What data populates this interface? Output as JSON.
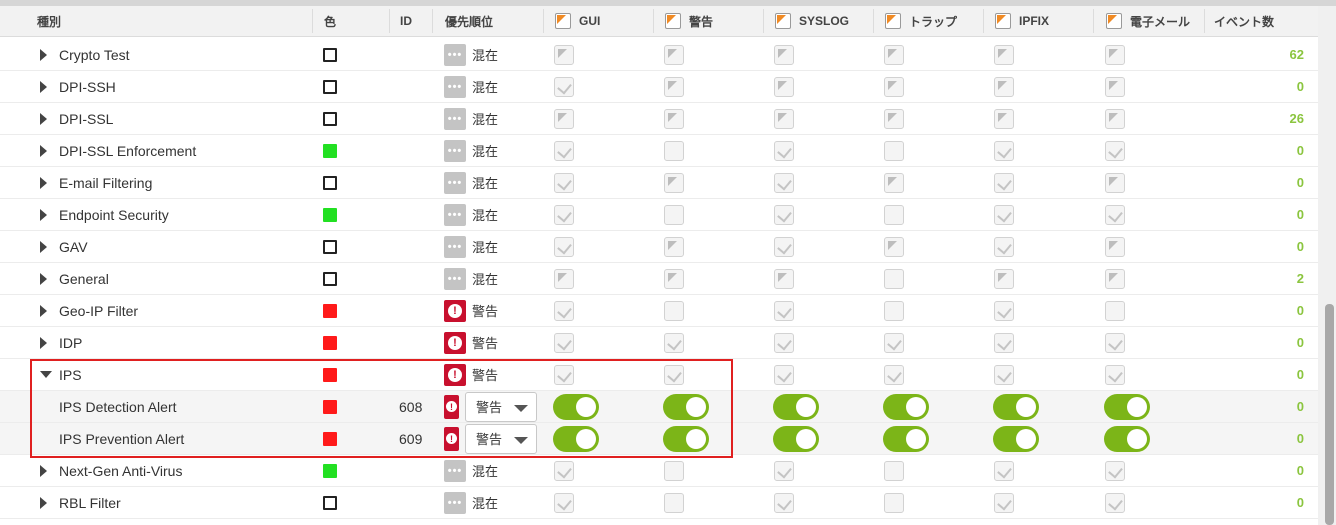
{
  "headers": {
    "type": "種別",
    "color": "色",
    "id": "ID",
    "priority": "優先順位",
    "gui": "GUI",
    "alert": "警告",
    "syslog": "SYSLOG",
    "trap": "トラップ",
    "ipfix": "IPFIX",
    "email": "電子メール",
    "events": "イベント数"
  },
  "rows": [
    {
      "name": "Crypto Test",
      "color": "#ffffff",
      "id": "",
      "priority": "混在",
      "count": "62",
      "expanded": false,
      "checks": [
        "flag",
        "flag",
        "flag",
        "flag",
        "flag",
        "flag"
      ]
    },
    {
      "name": "DPI-SSH",
      "color": "#ffffff",
      "id": "",
      "priority": "混在",
      "count": "0",
      "expanded": false,
      "checks": [
        "tick",
        "flag",
        "flag",
        "flag",
        "flag",
        "flag"
      ]
    },
    {
      "name": "DPI-SSL",
      "color": "#ffffff",
      "id": "",
      "priority": "混在",
      "count": "26",
      "expanded": false,
      "checks": [
        "flag",
        "flag",
        "flag",
        "flag",
        "flag",
        "flag"
      ]
    },
    {
      "name": "DPI-SSL Enforcement",
      "color": "#22e022",
      "id": "",
      "priority": "混在",
      "count": "0",
      "expanded": false,
      "checks": [
        "tick",
        "none",
        "tick",
        "none",
        "tick",
        "tick"
      ]
    },
    {
      "name": "E-mail Filtering",
      "color": "#ffffff",
      "id": "",
      "priority": "混在",
      "count": "0",
      "expanded": false,
      "checks": [
        "tick",
        "flag",
        "tick",
        "flag",
        "tick",
        "flag"
      ]
    },
    {
      "name": "Endpoint Security",
      "color": "#22e022",
      "id": "",
      "priority": "混在",
      "count": "0",
      "expanded": false,
      "checks": [
        "tick",
        "none",
        "tick",
        "none",
        "tick",
        "tick"
      ]
    },
    {
      "name": "GAV",
      "color": "#ffffff",
      "id": "",
      "priority": "混在",
      "count": "0",
      "expanded": false,
      "checks": [
        "tick",
        "flag",
        "tick",
        "flag",
        "tick",
        "flag"
      ]
    },
    {
      "name": "General",
      "color": "#ffffff",
      "id": "",
      "priority": "混在",
      "count": "2",
      "expanded": false,
      "checks": [
        "flag",
        "flag",
        "flag",
        "none",
        "flag",
        "flag"
      ]
    },
    {
      "name": "Geo-IP Filter",
      "color": "#ff1a1a",
      "id": "",
      "priority": "警告",
      "count": "0",
      "expanded": false,
      "checks": [
        "tick",
        "none",
        "tick",
        "none",
        "tick",
        "none"
      ]
    },
    {
      "name": "IDP",
      "color": "#ff1a1a",
      "id": "",
      "priority": "警告",
      "count": "0",
      "expanded": false,
      "checks": [
        "tick",
        "tick",
        "tick",
        "tick",
        "tick",
        "tick"
      ]
    },
    {
      "name": "IPS",
      "color": "#ff1a1a",
      "id": "",
      "priority": "警告",
      "count": "0",
      "expanded": true,
      "checks": [
        "tick",
        "tick",
        "tick",
        "tick",
        "tick",
        "tick"
      ]
    },
    {
      "name": "IPS Detection Alert",
      "color": "#ff1a1a",
      "id": "608",
      "priority": "警告",
      "count": "0",
      "sub": true
    },
    {
      "name": "IPS Prevention Alert",
      "color": "#ff1a1a",
      "id": "609",
      "priority": "警告",
      "count": "0",
      "sub": true
    },
    {
      "name": "Next-Gen Anti-Virus",
      "color": "#22e022",
      "id": "",
      "priority": "混在",
      "count": "0",
      "expanded": false,
      "checks": [
        "tick",
        "none",
        "tick",
        "none",
        "tick",
        "tick"
      ]
    },
    {
      "name": "RBL Filter",
      "color": "#ffffff",
      "id": "",
      "priority": "混在",
      "count": "0",
      "expanded": false,
      "checks": [
        "tick",
        "none",
        "tick",
        "none",
        "tick",
        "tick"
      ]
    }
  ],
  "accent": "#7cb518",
  "highlight_color": "#e02020"
}
